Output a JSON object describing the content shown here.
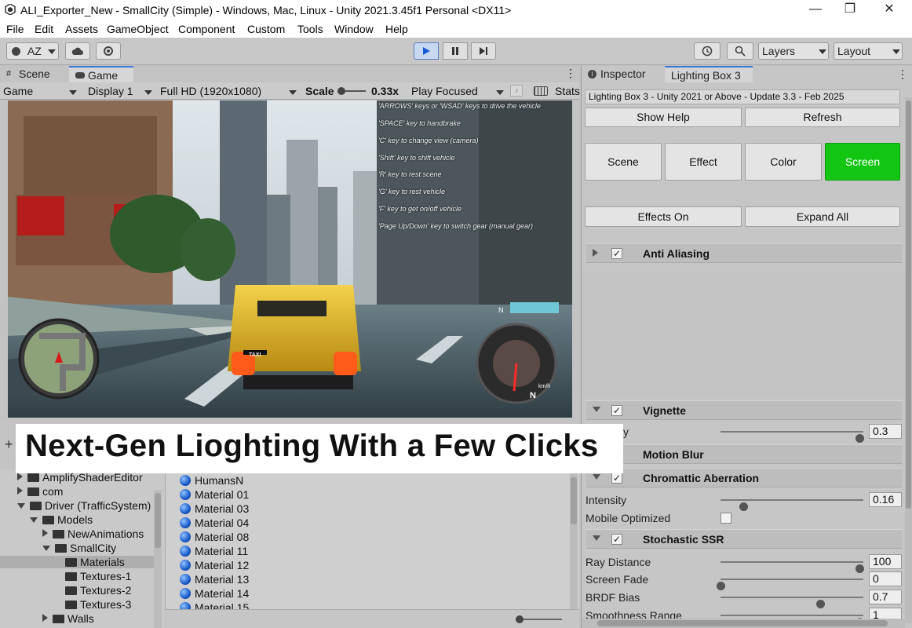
{
  "window": {
    "title": "ALI_Exporter_New - SmallCity (Simple) - Windows, Mac, Linux - Unity 2021.3.45f1 Personal <DX11>",
    "minimize": "—",
    "maximize": "❐",
    "close": "✕"
  },
  "menu": [
    "File",
    "Edit",
    "Assets",
    "GameObject",
    "Component",
    "Custom",
    "Tools",
    "Window",
    "Help"
  ],
  "toolbar": {
    "account": "AZ",
    "play_icon": "play-icon",
    "layers": "Layers",
    "layout": "Layout"
  },
  "game_panel": {
    "tabs": [
      "Scene",
      "Game"
    ],
    "active_tab": "Game",
    "view_select": "Game",
    "display": "Display 1",
    "resolution": "Full HD (1920x1080)",
    "scale_label": "Scale",
    "scale_value": "0.33x",
    "play_mode": "Play Focused",
    "stats": "Stats",
    "hints": [
      "'ARROWS' keys or 'WSAD' keys to drive the vehicle",
      "'SPACE' key to handbrake",
      "'C' key to change view (camera)",
      "'Shift' key to shift vehicle",
      "'R' key to rest scene",
      "'G' key to rest vehicle",
      "'F' key to get on/off vehicle",
      "'Page Up/Down' key to switch gear (manual gear)"
    ],
    "speedo_gear": "N",
    "speedo_unit": "km/h",
    "compass_letter": "N",
    "taxi_sign": "TAXI"
  },
  "inspector": {
    "tabs": [
      "Inspector",
      "Lighting Box 3"
    ],
    "active_tab": "Lighting Box 3",
    "version": "Lighting Box 3 - Unity 2021 or Above - Update 3.3 - Feb 2025",
    "show_help": "Show Help",
    "refresh": "Refresh",
    "category_tabs": [
      "Scene",
      "Effect",
      "Color",
      "Screen"
    ],
    "active_category": "Screen",
    "effects_on": "Effects On",
    "expand_all": "Expand All",
    "sections": {
      "anti_aliasing": "Anti Aliasing",
      "vignette": "Vignette",
      "motion_blur": "Motion Blur",
      "chromatic": "Chromattic Aberration",
      "ssr": "Stochastic SSR"
    },
    "vignette_intensity_label": "y",
    "vignette_intensity": "0.3",
    "vignette_level": 0.97,
    "chromatic_intensity_label": "Intensity",
    "chromatic_intensity": "0.16",
    "chromatic_level": 0.16,
    "mobile_optimized_label": "Mobile Optimized",
    "ssr_rows": [
      {
        "label": "Ray Distance",
        "value": "100",
        "level": 0.97
      },
      {
        "label": "Screen Fade",
        "value": "0",
        "level": 0.0
      },
      {
        "label": "BRDF Bias",
        "value": "0.7",
        "level": 0.7
      },
      {
        "label": "Smoothness Range",
        "value": "1",
        "level": 0.97
      }
    ]
  },
  "project": {
    "tree": [
      {
        "label": "AmplifyShaderEditor",
        "indent": 0,
        "state": "collapsed"
      },
      {
        "label": "com",
        "indent": 0,
        "state": "collapsed"
      },
      {
        "label": "Driver (TrafficSystem)",
        "indent": 0,
        "state": "expanded"
      },
      {
        "label": "Models",
        "indent": 1,
        "state": "expanded"
      },
      {
        "label": "NewAnimations",
        "indent": 2,
        "state": "collapsed"
      },
      {
        "label": "SmallCity",
        "indent": 2,
        "state": "expanded"
      },
      {
        "label": "Materials",
        "indent": 3,
        "state": "none",
        "selected": true
      },
      {
        "label": "Textures-1",
        "indent": 3,
        "state": "none"
      },
      {
        "label": "Textures-2",
        "indent": 3,
        "state": "none"
      },
      {
        "label": "Textures-3",
        "indent": 3,
        "state": "none"
      },
      {
        "label": "Walls",
        "indent": 2,
        "state": "collapsed"
      }
    ],
    "materials": [
      "HumansN",
      "Material 01",
      "Material 03",
      "Material 04",
      "Material 08",
      "Material 11",
      "Material 12",
      "Material 13",
      "Material 14",
      "Material 15"
    ]
  },
  "banner": "Next-Gen Lioghting With a Few Clicks"
}
